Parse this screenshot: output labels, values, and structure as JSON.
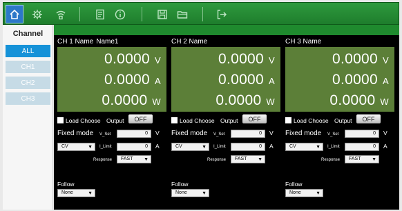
{
  "toolbar": {
    "buttons": [
      {
        "name": "home-icon",
        "type": "home"
      },
      {
        "name": "settings-icon",
        "type": "gear"
      },
      {
        "name": "network-icon",
        "type": "network"
      },
      {
        "name": "save-as-icon",
        "type": "doc"
      },
      {
        "name": "info-icon",
        "type": "info"
      },
      {
        "name": "save-icon",
        "type": "disk"
      },
      {
        "name": "open-folder-icon",
        "type": "folder"
      },
      {
        "name": "exit-icon",
        "type": "exit"
      }
    ]
  },
  "sidebar": {
    "title": "Channel",
    "items": [
      {
        "label": "ALL",
        "active": true
      },
      {
        "label": "CH1",
        "active": false
      },
      {
        "label": "CH2",
        "active": false
      },
      {
        "label": "CH3",
        "active": false
      }
    ]
  },
  "channels": [
    {
      "header": "CH  1  Name",
      "name": "Name1",
      "voltage": "0.0000",
      "voltage_unit": "V",
      "current": "0.0000",
      "current_unit": "A",
      "power": "0.0000",
      "power_unit": "W",
      "load_choose": "Load Choose",
      "output_label": "Output",
      "output_state": "OFF",
      "mode": "Fixed mode",
      "v_set_label": "V_Set",
      "v_set": "0",
      "v_unit": "V",
      "i_limit_label": "I_Limit",
      "i_limit": "0",
      "i_unit": "A",
      "cv_mode": "CV",
      "response_label": "Response",
      "response": "FAST",
      "follow_label": "Follow",
      "follow": "None"
    },
    {
      "header": "CH  2  Name",
      "name": "",
      "voltage": "0.0000",
      "voltage_unit": "V",
      "current": "0.0000",
      "current_unit": "A",
      "power": "0.0000",
      "power_unit": "W",
      "load_choose": "Load Choose",
      "output_label": "Output",
      "output_state": "OFF",
      "mode": "Fixed mode",
      "v_set_label": "V_Set",
      "v_set": "0",
      "v_unit": "V",
      "i_limit_label": "I_Limit",
      "i_limit": "0",
      "i_unit": "A",
      "cv_mode": "CV",
      "response_label": "Response",
      "response": "FAST",
      "follow_label": "Follow",
      "follow": "None"
    },
    {
      "header": "CH  3  Name",
      "name": "",
      "voltage": "0.0000",
      "voltage_unit": "V",
      "current": "0.0000",
      "current_unit": "A",
      "power": "0.0000",
      "power_unit": "W",
      "load_choose": "Load Choose",
      "output_label": "Output",
      "output_state": "OFF",
      "mode": "Fixed mode",
      "v_set_label": "V_Set",
      "v_set": "0",
      "v_unit": "V",
      "i_limit_label": "I_Limit",
      "i_limit": "0",
      "i_unit": "A",
      "cv_mode": "CV",
      "response_label": "Response",
      "response": "FAST",
      "follow_label": "Follow",
      "follow": "None"
    }
  ],
  "colors": {
    "toolbar": "#1e7d2c",
    "display": "#5c7f38",
    "active_tab": "#1692d8",
    "inactive_tab": "#c6dbe6"
  }
}
